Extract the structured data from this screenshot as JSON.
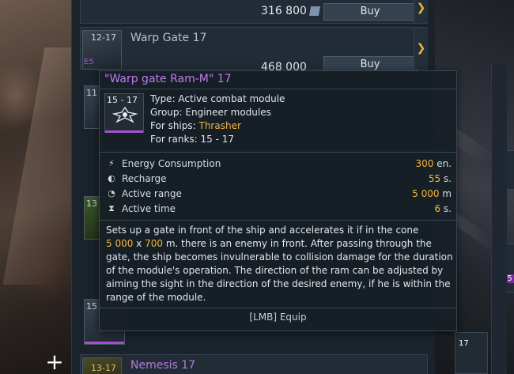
{
  "store": {
    "rows": [
      {
        "level": "",
        "name": "",
        "price": "316 800",
        "buy_label": "Buy",
        "badge": "E5"
      },
      {
        "level": "12-17",
        "name": "Warp Gate 17",
        "price": "468 000",
        "buy_label": "Buy",
        "badge": "E5"
      },
      {
        "level": "13-17",
        "name": "Nemesis 17"
      }
    ],
    "side_badges": [
      "E5",
      "E5",
      "11",
      "13",
      "15"
    ],
    "plus_label": "+"
  },
  "right_panel": {
    "badges": [
      "E5",
      "17"
    ]
  },
  "tooltip": {
    "title": "\"Warp gate Ram-M\" 17",
    "icon_level": "15 - 17",
    "type_label": "Type: Active combat module",
    "group_label": "Group: Engineer modules",
    "ships_prefix": "For ships: ",
    "ships_value": "Thrasher",
    "ranks_label": "For ranks: 15 - 17",
    "stats": [
      {
        "icon": "lightning-icon",
        "label": "Energy Consumption",
        "value": "300",
        "unit": " en."
      },
      {
        "icon": "recharge-icon",
        "label": "Recharge",
        "value": "55",
        "unit": " s."
      },
      {
        "icon": "range-icon",
        "label": "Active range",
        "value": "5 000",
        "unit": " m"
      },
      {
        "icon": "hourglass-icon",
        "label": "Active time",
        "value": "6",
        "unit": " s."
      }
    ],
    "description": {
      "part1": "Sets up a gate in front of the ship and accelerates it if in the cone",
      "dim_a": "5 000",
      "x": " x ",
      "dim_b": "700",
      "part2": " m. there is an enemy in front. After passing through the gate, the ship becomes invulnerable to collision damage for the duration of the module's operation. The direction of the ram can be adjusted by aiming the sight in the direction of the desired enemy, if he is within the range of the module."
    },
    "equip_hint": "[LMB] Equip"
  },
  "colors": {
    "accent_purple": "#a84fd0",
    "title_purple": "#c07af0",
    "highlight_orange": "#f2b53b"
  }
}
